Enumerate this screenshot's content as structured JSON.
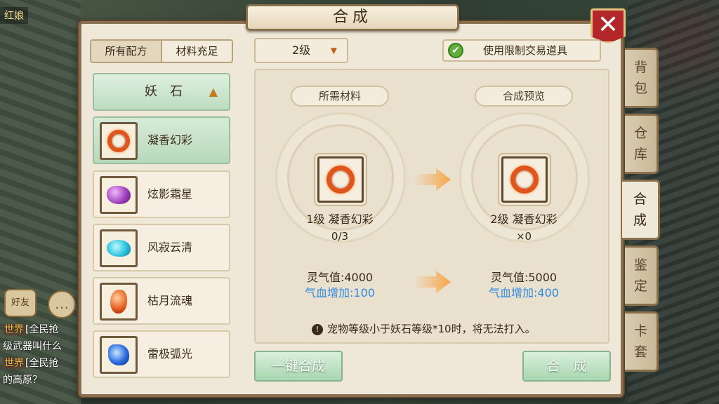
{
  "hud": {
    "corner_name": "红娘",
    "friend_label": "好友",
    "chat_icon": "chat-bubble-icon",
    "chat_lines": [
      {
        "tag": "世界",
        "text": "[全民抢"
      },
      {
        "tag": "",
        "text": "级武器叫什么"
      },
      {
        "tag": "世界",
        "text": "[全民抢"
      },
      {
        "tag": "",
        "text": "的高原？"
      }
    ]
  },
  "window": {
    "title": "合成",
    "close_label": "✕"
  },
  "left": {
    "tabs": [
      {
        "label": "所有配方",
        "active": true
      },
      {
        "label": "材料充足",
        "active": false
      }
    ],
    "category": {
      "label": "妖石",
      "arrow": "^"
    },
    "items": [
      {
        "name": "凝香幻彩",
        "icon": "ring-gem-icon",
        "selected": true
      },
      {
        "name": "炫影霜星",
        "icon": "purple-gem-icon",
        "selected": false
      },
      {
        "name": "风寂云清",
        "icon": "cyan-gem-icon",
        "selected": false
      },
      {
        "name": "枯月流魂",
        "icon": "orange-gem-icon",
        "selected": false
      },
      {
        "name": "雷极弧光",
        "icon": "blue-gem-icon",
        "selected": false
      }
    ]
  },
  "main": {
    "level_select": "2级",
    "use_restricted_label": "使用限制交易道具",
    "use_restricted_checked": true,
    "required_title": "所需材料",
    "preview_title": "合成预览",
    "input": {
      "name": "1级 凝香幻彩",
      "count": "0/3",
      "spirit": "灵气值:4000",
      "hp": "气血增加:100"
    },
    "output": {
      "name": "2级 凝香幻彩",
      "count": "×0",
      "spirit": "灵气值:5000",
      "hp": "气血增加:400"
    },
    "warning": "宠物等级小于妖石等级*10时，将无法打入。",
    "one_click_label": "一键合成",
    "compose_label": "合　成"
  },
  "side_tabs": [
    {
      "label": "背包",
      "active": false
    },
    {
      "label": "仓库",
      "active": false
    },
    {
      "label": "合成",
      "active": true
    },
    {
      "label": "鉴定",
      "active": false
    },
    {
      "label": "卡套",
      "active": false
    }
  ],
  "colors": {
    "accent_green": "#b7d8bb",
    "close_red": "#b3262a",
    "stat_blue": "#2f8ae0",
    "frame_brown": "#8a6f4c"
  }
}
